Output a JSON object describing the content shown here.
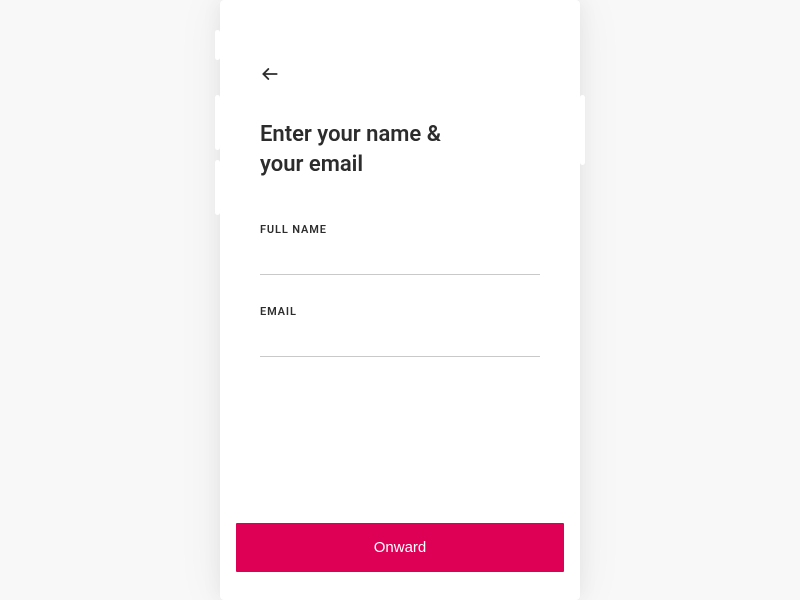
{
  "header": {
    "title": "Enter your name & your email"
  },
  "form": {
    "fullName": {
      "label": "FULL NAME",
      "value": ""
    },
    "email": {
      "label": "EMAIL",
      "value": ""
    }
  },
  "cta": {
    "label": "Onward"
  },
  "colors": {
    "accent": "#de0055"
  }
}
